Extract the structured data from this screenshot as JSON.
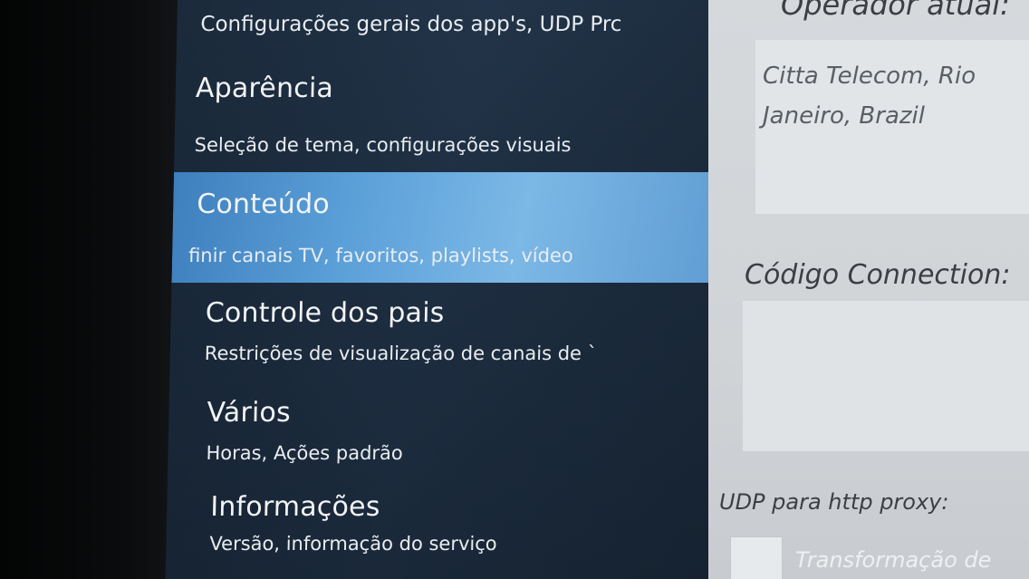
{
  "menu": {
    "top_item": {
      "subtitle": "Configurações gerais dos app's, UDP Prc"
    },
    "items": [
      {
        "title": "Aparência",
        "subtitle": "Seleção de tema, configurações visuais"
      },
      {
        "title": "Conteúdo",
        "subtitle": "finir canais TV, favoritos, playlists, vídeo"
      },
      {
        "title": "Controle dos pais",
        "subtitle": "Restrições de visualização de canais de `"
      },
      {
        "title": "Vários",
        "subtitle": "Horas, Ações padrão"
      },
      {
        "title": "Informações",
        "subtitle": "Versão, informação do serviço"
      }
    ],
    "selected_index": 1,
    "highlight_color": "#5a9fd8",
    "background_color": "#1f3045"
  },
  "details": {
    "operator_label": "Operador atual:",
    "operator_value": "Citta Telecom, Rio Janeiro, Brazil",
    "connection_label": "Código Connection:",
    "connection_value": "",
    "udp_label": "UDP para http proxy:",
    "transform_label": "Transformação de",
    "transform_checked": false
  }
}
